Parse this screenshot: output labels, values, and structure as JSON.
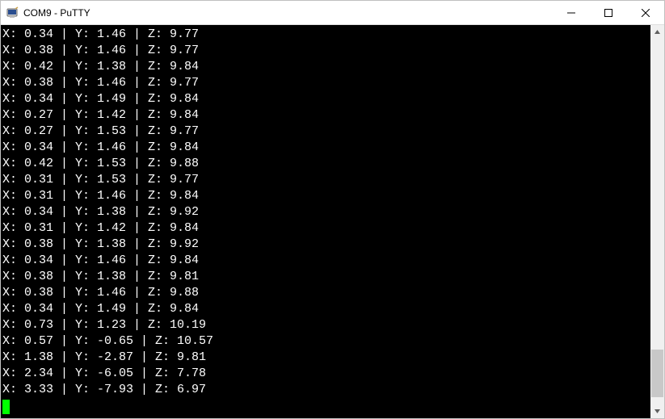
{
  "window": {
    "title": "COM9 - PuTTY"
  },
  "terminal": {
    "lines": [
      "X: 0.34 | Y: 1.46 | Z: 9.77",
      "X: 0.38 | Y: 1.46 | Z: 9.77",
      "X: 0.42 | Y: 1.38 | Z: 9.84",
      "X: 0.38 | Y: 1.46 | Z: 9.77",
      "X: 0.34 | Y: 1.49 | Z: 9.84",
      "X: 0.27 | Y: 1.42 | Z: 9.84",
      "X: 0.27 | Y: 1.53 | Z: 9.77",
      "X: 0.34 | Y: 1.46 | Z: 9.84",
      "X: 0.42 | Y: 1.53 | Z: 9.88",
      "X: 0.31 | Y: 1.53 | Z: 9.77",
      "X: 0.31 | Y: 1.46 | Z: 9.84",
      "X: 0.34 | Y: 1.38 | Z: 9.92",
      "X: 0.31 | Y: 1.42 | Z: 9.84",
      "X: 0.38 | Y: 1.38 | Z: 9.92",
      "X: 0.34 | Y: 1.46 | Z: 9.84",
      "X: 0.38 | Y: 1.38 | Z: 9.81",
      "X: 0.38 | Y: 1.46 | Z: 9.88",
      "X: 0.34 | Y: 1.49 | Z: 9.84",
      "X: 0.73 | Y: 1.23 | Z: 10.19",
      "X: 0.57 | Y: -0.65 | Z: 10.57",
      "X: 1.38 | Y: -2.87 | Z: 9.81",
      "X: 2.34 | Y: -6.05 | Z: 7.78",
      "X: 3.33 | Y: -7.93 | Z: 6.97"
    ]
  },
  "scrollbar": {
    "thumb_top_pct": 85,
    "thumb_height_pct": 13
  },
  "colors": {
    "terminal_bg": "#000000",
    "terminal_fg": "#ffffff",
    "cursor": "#00ff00",
    "window_bg": "#ffffff"
  }
}
